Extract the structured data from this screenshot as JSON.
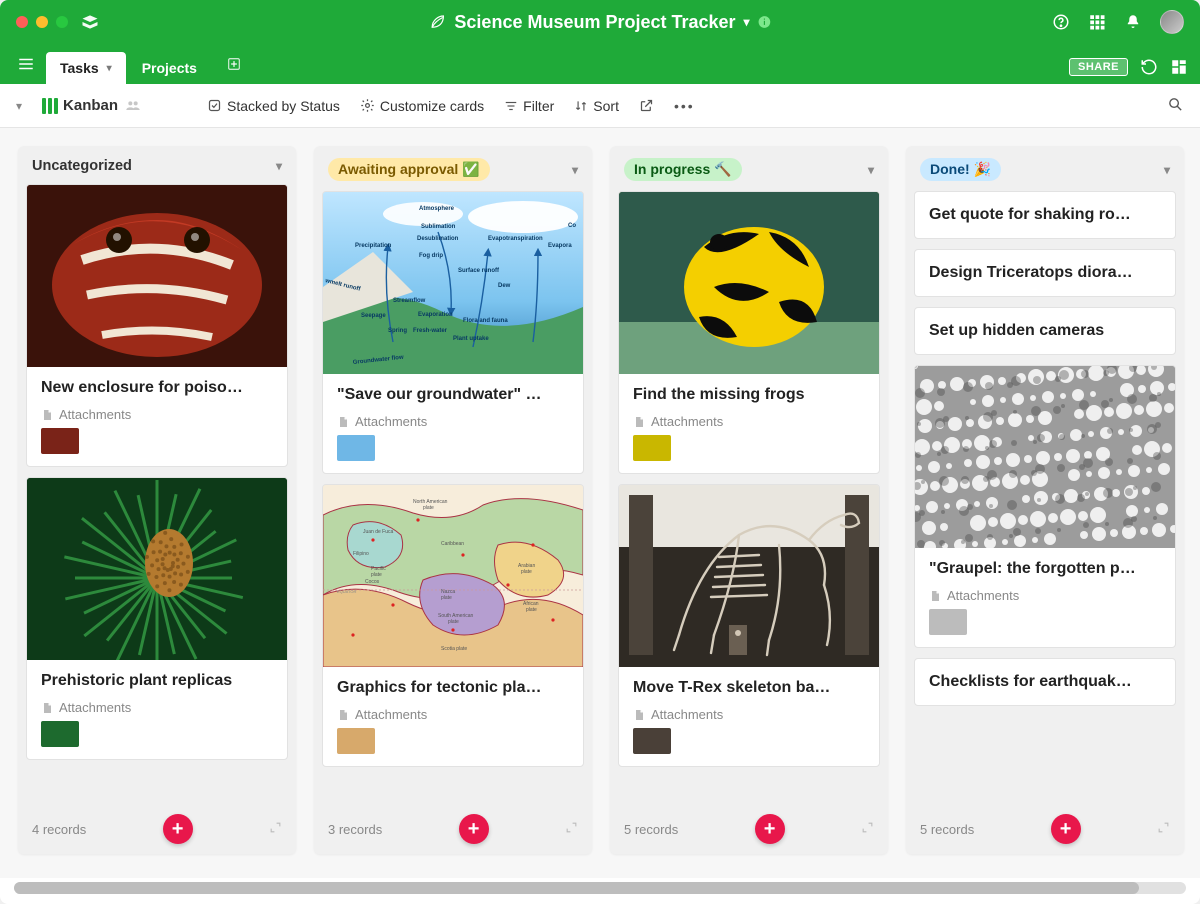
{
  "header": {
    "title": "Science Museum Project Tracker"
  },
  "tabs": {
    "tasks": "Tasks",
    "projects": "Projects"
  },
  "share_label": "SHARE",
  "toolbar": {
    "board_name": "Kanban",
    "stacked": "Stacked by Status",
    "customize": "Customize cards",
    "filter": "Filter",
    "sort": "Sort"
  },
  "columns": [
    {
      "key": "uncategorized",
      "title": "Uncategorized",
      "pill": false,
      "footer": "4 records",
      "cards": [
        {
          "title": "New enclosure for poiso…",
          "attachments": "Attachments",
          "cover": "cover-frog-red",
          "thumb": "#7a2318"
        },
        {
          "title": "Prehistoric plant replicas",
          "attachments": "Attachments",
          "cover": "cover-plant",
          "thumb": "#1d6a2e"
        }
      ]
    },
    {
      "key": "awaiting",
      "title": "Awaiting approval ✅",
      "pill": true,
      "pill_bg": "#ffe9a8",
      "pill_color": "#7a5a00",
      "footer": "3 records",
      "cards": [
        {
          "title": "\"Save our groundwater\" …",
          "attachments": "Attachments",
          "cover": "cover-water",
          "thumb": "#6fb7e6"
        },
        {
          "title": "Graphics for tectonic pla…",
          "attachments": "Attachments",
          "cover": "cover-tectonic",
          "thumb": "#d7a96b"
        }
      ]
    },
    {
      "key": "inprogress",
      "title": "In progress 🔨",
      "pill": true,
      "pill_bg": "#c7f2c9",
      "pill_color": "#0a5a14",
      "footer": "5 records",
      "cards": [
        {
          "title": "Find the missing frogs",
          "attachments": "Attachments",
          "cover": "cover-frog-yb",
          "thumb": "#c9b700"
        },
        {
          "title": "Move T-Rex skeleton ba…",
          "attachments": "Attachments",
          "cover": "cover-trex",
          "thumb": "#4a4038"
        }
      ]
    },
    {
      "key": "done",
      "title": "Done! 🎉",
      "pill": true,
      "pill_bg": "#c9e9ff",
      "pill_color": "#0a4a78",
      "footer": "5 records",
      "simple_first": true,
      "cards": [
        {
          "simple": true,
          "title": "Get quote for shaking ro…"
        },
        {
          "simple": true,
          "title": "Design Triceratops diora…"
        },
        {
          "simple": true,
          "title": "Set up hidden cameras"
        },
        {
          "title": "\"Graupel: the forgotten p…",
          "attachments": "Attachments",
          "cover": "cover-graupel",
          "thumb": "#bcbcbc"
        },
        {
          "simple": true,
          "title": "Checklists for earthquak…"
        }
      ]
    }
  ]
}
